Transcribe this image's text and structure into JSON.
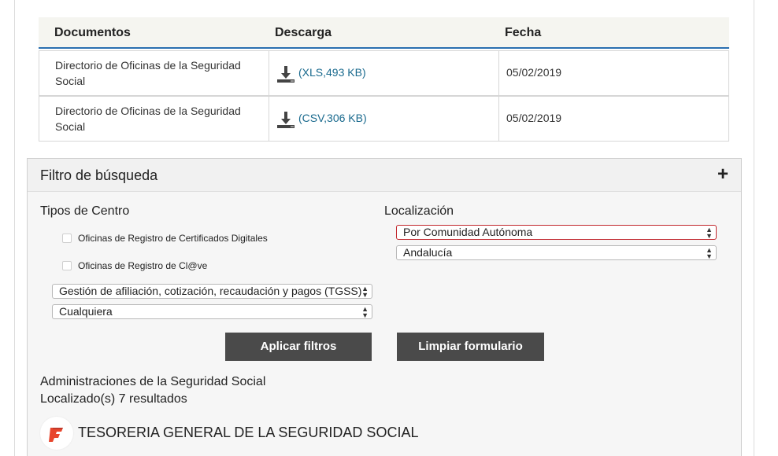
{
  "downloads": {
    "headers": {
      "documents": "Documentos",
      "download": "Descarga",
      "date": "Fecha"
    },
    "rows": [
      {
        "title": "Directorio de Oficinas de la Seguridad Social",
        "link": "(XLS,493 KB)",
        "date": "05/02/2019"
      },
      {
        "title": "Directorio de Oficinas de la Seguridad Social",
        "link": "(CSV,306 KB)",
        "date": "05/02/2019"
      }
    ]
  },
  "filter": {
    "title": "Filtro de búsqueda",
    "toggle": "+",
    "center_types_label": "Tipos de Centro",
    "checkboxes": [
      {
        "label": "Oficinas de Registro de Certificados Digitales",
        "checked": false
      },
      {
        "label": "Oficinas de Registro de Cl@ve",
        "checked": false
      }
    ],
    "management_select": "Gestión de afiliación, cotización, recaudación y pagos (TGSS)",
    "any_select": "Cualquiera",
    "location_label": "Localización",
    "location_type_select": "Por Comunidad Autónoma",
    "region_select": "Andalucía",
    "apply_button": "Aplicar filtros",
    "clear_button": "Limpiar formulario"
  },
  "results": {
    "heading": "Administraciones de la Seguridad Social",
    "count": "Localizado(s) 7 resultados",
    "first_org": "TESORERIA GENERAL DE LA SEGURIDAD SOCIAL"
  },
  "colors": {
    "link": "#1a6a8e",
    "button": "#4a4a4a",
    "active_select_border": "#c1272d",
    "header_underline": "#2a6fb0",
    "logo": "#e8452c"
  }
}
